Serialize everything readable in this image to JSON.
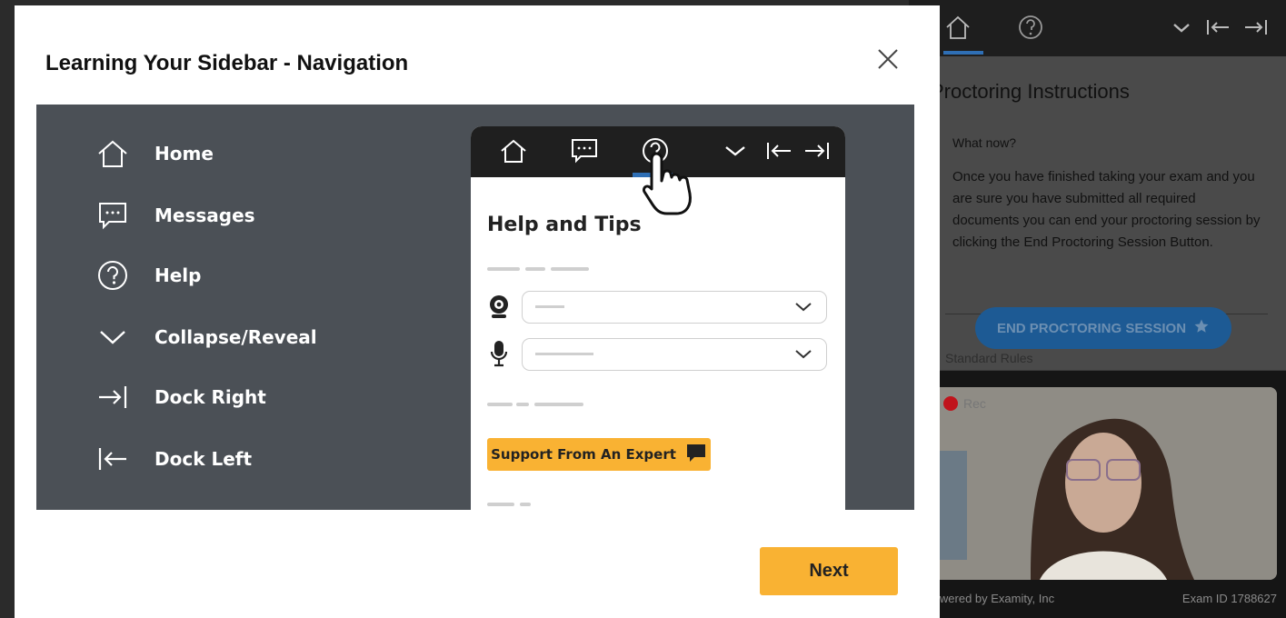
{
  "modal": {
    "title": "Learning Your Sidebar - Navigation",
    "close_icon": "close-icon",
    "next_label": "Next"
  },
  "legend": {
    "items": [
      {
        "icon": "home-icon",
        "label": "Home"
      },
      {
        "icon": "messages-icon",
        "label": "Messages"
      },
      {
        "icon": "help-icon",
        "label": "Help"
      },
      {
        "icon": "chevron-down-icon",
        "label": "Collapse/Reveal"
      },
      {
        "icon": "dock-right-icon",
        "label": "Dock Right"
      },
      {
        "icon": "dock-left-icon",
        "label": "Dock Left"
      }
    ]
  },
  "mockup": {
    "title": "Help and Tips",
    "support_label": "Support From An Expert"
  },
  "sidebar": {
    "title": "Proctoring Instructions",
    "subheading": "What now?",
    "body": "Once you have finished taking your exam and you are sure you have submitted all required documents you can end your proctoring session by clicking the End Proctoring Session Button.",
    "end_button": "END PROCTORING SESSION",
    "section_partial": "Standard Rules",
    "rec_label": "Rec",
    "powered_by": "Powered by Examity, Inc",
    "exam_id": "Exam ID 1788627"
  },
  "colors": {
    "accent_yellow": "#f9b233",
    "accent_blue": "#2f6fb5",
    "illustration_bg": "#4b5056",
    "rec_red": "#c0141c"
  }
}
